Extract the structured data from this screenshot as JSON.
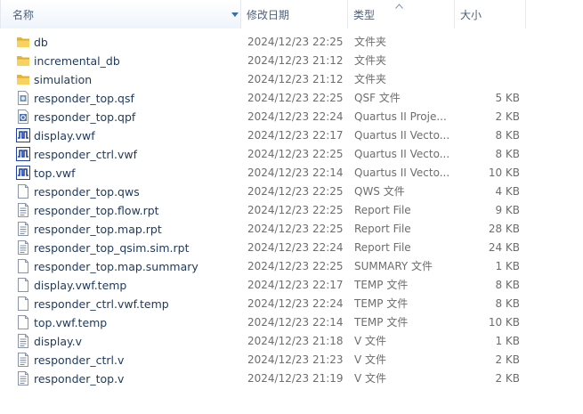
{
  "columns": {
    "name": "名称",
    "date": "修改日期",
    "type": "类型",
    "size": "大小"
  },
  "files": [
    {
      "name": "db",
      "date": "2024/12/23 22:25",
      "type": "文件夹",
      "size": "",
      "icon": "folder-icon"
    },
    {
      "name": "incremental_db",
      "date": "2024/12/23 21:12",
      "type": "文件夹",
      "size": "",
      "icon": "folder-icon"
    },
    {
      "name": "simulation",
      "date": "2024/12/23 21:12",
      "type": "文件夹",
      "size": "",
      "icon": "folder-icon"
    },
    {
      "name": "responder_top.qsf",
      "date": "2024/12/23 22:25",
      "type": "QSF 文件",
      "size": "5 KB",
      "icon": "settings-file-icon"
    },
    {
      "name": "responder_top.qpf",
      "date": "2024/12/23 22:24",
      "type": "Quartus II Proje...",
      "size": "2 KB",
      "icon": "quartus-project-icon"
    },
    {
      "name": "display.vwf",
      "date": "2024/12/23 22:17",
      "type": "Quartus II Vecto...",
      "size": "8 KB",
      "icon": "waveform-icon"
    },
    {
      "name": "responder_ctrl.vwf",
      "date": "2024/12/23 22:25",
      "type": "Quartus II Vecto...",
      "size": "8 KB",
      "icon": "waveform-icon"
    },
    {
      "name": "top.vwf",
      "date": "2024/12/23 22:14",
      "type": "Quartus II Vecto...",
      "size": "10 KB",
      "icon": "waveform-icon"
    },
    {
      "name": "responder_top.qws",
      "date": "2024/12/23 22:25",
      "type": "QWS 文件",
      "size": "4 KB",
      "icon": "blank-file-icon"
    },
    {
      "name": "responder_top.flow.rpt",
      "date": "2024/12/23 22:25",
      "type": "Report File",
      "size": "9 KB",
      "icon": "text-file-icon"
    },
    {
      "name": "responder_top.map.rpt",
      "date": "2024/12/23 22:25",
      "type": "Report File",
      "size": "28 KB",
      "icon": "text-file-icon"
    },
    {
      "name": "responder_top_qsim.sim.rpt",
      "date": "2024/12/23 22:24",
      "type": "Report File",
      "size": "24 KB",
      "icon": "text-file-icon"
    },
    {
      "name": "responder_top.map.summary",
      "date": "2024/12/23 22:25",
      "type": "SUMMARY 文件",
      "size": "1 KB",
      "icon": "blank-file-icon"
    },
    {
      "name": "display.vwf.temp",
      "date": "2024/12/23 22:17",
      "type": "TEMP 文件",
      "size": "8 KB",
      "icon": "blank-file-icon"
    },
    {
      "name": "responder_ctrl.vwf.temp",
      "date": "2024/12/23 22:24",
      "type": "TEMP 文件",
      "size": "8 KB",
      "icon": "blank-file-icon"
    },
    {
      "name": "top.vwf.temp",
      "date": "2024/12/23 22:14",
      "type": "TEMP 文件",
      "size": "10 KB",
      "icon": "blank-file-icon"
    },
    {
      "name": "display.v",
      "date": "2024/12/23 21:18",
      "type": "V 文件",
      "size": "1 KB",
      "icon": "text-file-icon"
    },
    {
      "name": "responder_ctrl.v",
      "date": "2024/12/23 21:23",
      "type": "V 文件",
      "size": "2 KB",
      "icon": "text-file-icon"
    },
    {
      "name": "responder_top.v",
      "date": "2024/12/23 21:19",
      "type": "V 文件",
      "size": "2 KB",
      "icon": "text-file-icon"
    }
  ]
}
